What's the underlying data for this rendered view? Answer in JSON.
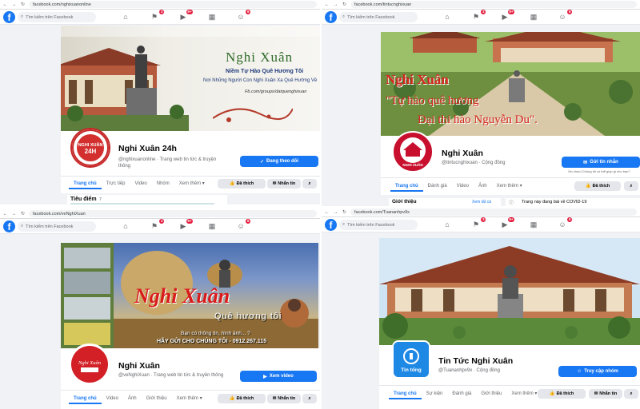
{
  "common": {
    "search_placeholder": "Tìm kiếm trên Facebook",
    "fb_logo": "f",
    "nav_icons": [
      "home-icon",
      "flag-icon",
      "video-icon",
      "marketplace-icon",
      "groups-icon"
    ]
  },
  "q1": {
    "url": "facebook.com/nghixuanonline",
    "badges": [
      "3",
      "9+",
      "6"
    ],
    "cover": {
      "title": "Nghi Xuân",
      "line1": "Niềm Tự Hào Quê Hương Tôi",
      "line2": "Nơi Những Người Con Nghi Xuân Xa Quê Hướng Về",
      "line3": "Fb.com/groups/datquenghixuan"
    },
    "logo_text": "NGHI XUÂN\n24H",
    "name": "Nghi Xuân 24h",
    "subtitle": "@nghixuanonline · Trang web tin tức & truyện thông",
    "cta": "Đang theo dõi",
    "tabs": [
      "Trang chủ",
      "Trực tiếp",
      "Video",
      "Nhóm",
      "Xem thêm ▾"
    ],
    "like": "Đã thích",
    "message": "Nhắn tin",
    "section": "Tiêu điểm",
    "section_count": "7"
  },
  "q2": {
    "url": "facebook.com/tintucnghixuan",
    "badges": [
      "3",
      "9+",
      "6"
    ],
    "cover": {
      "title": "Nghi Xuân",
      "quote1": "\"Tự hào quê hương",
      "quote2": "Đại thi hào Nguyễn Du\"."
    },
    "logo_text": "NGHI XUÂN",
    "name": "Nghi Xuân",
    "subtitle": "@tintucnghixuan · Cộng đồng",
    "cta": "Gửi tin nhắn",
    "cta_note": "Xin chào! Chúng tôi có thể giúp gì cho bạn?",
    "tabs": [
      "Trang chủ",
      "Đánh giá",
      "Video",
      "Ảnh",
      "Xem thêm ▾"
    ],
    "like": "Đã thích",
    "intro": "Giới thiệu",
    "see_all": "Xem tất cả",
    "post": "Trang này đang bài về COVID-19"
  },
  "q3": {
    "url": "facebook.com/veNghiXuan",
    "badges": [
      "3",
      "9+",
      "6"
    ],
    "cover": {
      "title": "Nghi Xuân",
      "subtitle": "Quê hương tôi",
      "line1": "Bạn có thông tin, hình ảnh... ?",
      "line2": "HÃY GỬI CHO CHÚNG TÔI - 0912.267.115"
    },
    "logo_text": "Nghi Xuân",
    "name": "Nghi Xuân",
    "subtitle": "@veNghiXuan · Trang web tin tức & truyền thông",
    "cta": "Xem video",
    "tabs": [
      "Trang chủ",
      "Video",
      "Ảnh",
      "Giới thiệu",
      "Xem thêm ▾"
    ],
    "like": "Đã thích",
    "message": "Nhắn tin"
  },
  "q4": {
    "url": "facebook.com/Tuananhpv9x",
    "badges": [
      "3",
      "9+",
      "6"
    ],
    "logo_text": "Tin tổng",
    "name": "Tin Tức Nghi Xuân",
    "subtitle": "@Tuananhpv9x · Cộng đồng",
    "cta": "Truy cập nhóm",
    "tabs": [
      "Trang chủ",
      "Sự kiện",
      "Đánh giá",
      "Giới thiệu",
      "Xem thêm ▾"
    ],
    "like": "Đã thích",
    "message": "Nhắn tin"
  }
}
